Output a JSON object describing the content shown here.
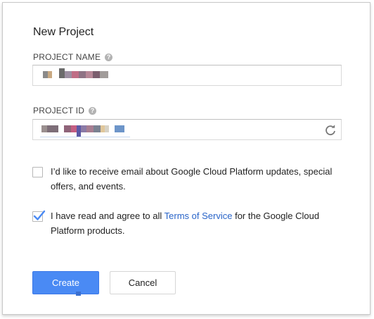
{
  "dialog": {
    "title": "New Project"
  },
  "project_name": {
    "label": "PROJECT NAME",
    "help_icon": "help-icon",
    "value_redacted": true
  },
  "project_id": {
    "label": "PROJECT ID",
    "help_icon": "help-icon",
    "refresh_icon": "refresh-icon",
    "value_redacted": true
  },
  "email_opt_in": {
    "checked": false,
    "text": "I’d like to receive email about Google Cloud Platform updates, special offers, and events."
  },
  "terms": {
    "checked": true,
    "text_before": "I have read and agree to all ",
    "link_text": "Terms of Service",
    "text_after": " for the Google Cloud Platform products."
  },
  "buttons": {
    "create_label": "Create",
    "cancel_label": "Cancel"
  },
  "colors": {
    "primary_button": "#4a8af4",
    "link": "#2a65c9",
    "checkmark": "#4a8af4"
  }
}
